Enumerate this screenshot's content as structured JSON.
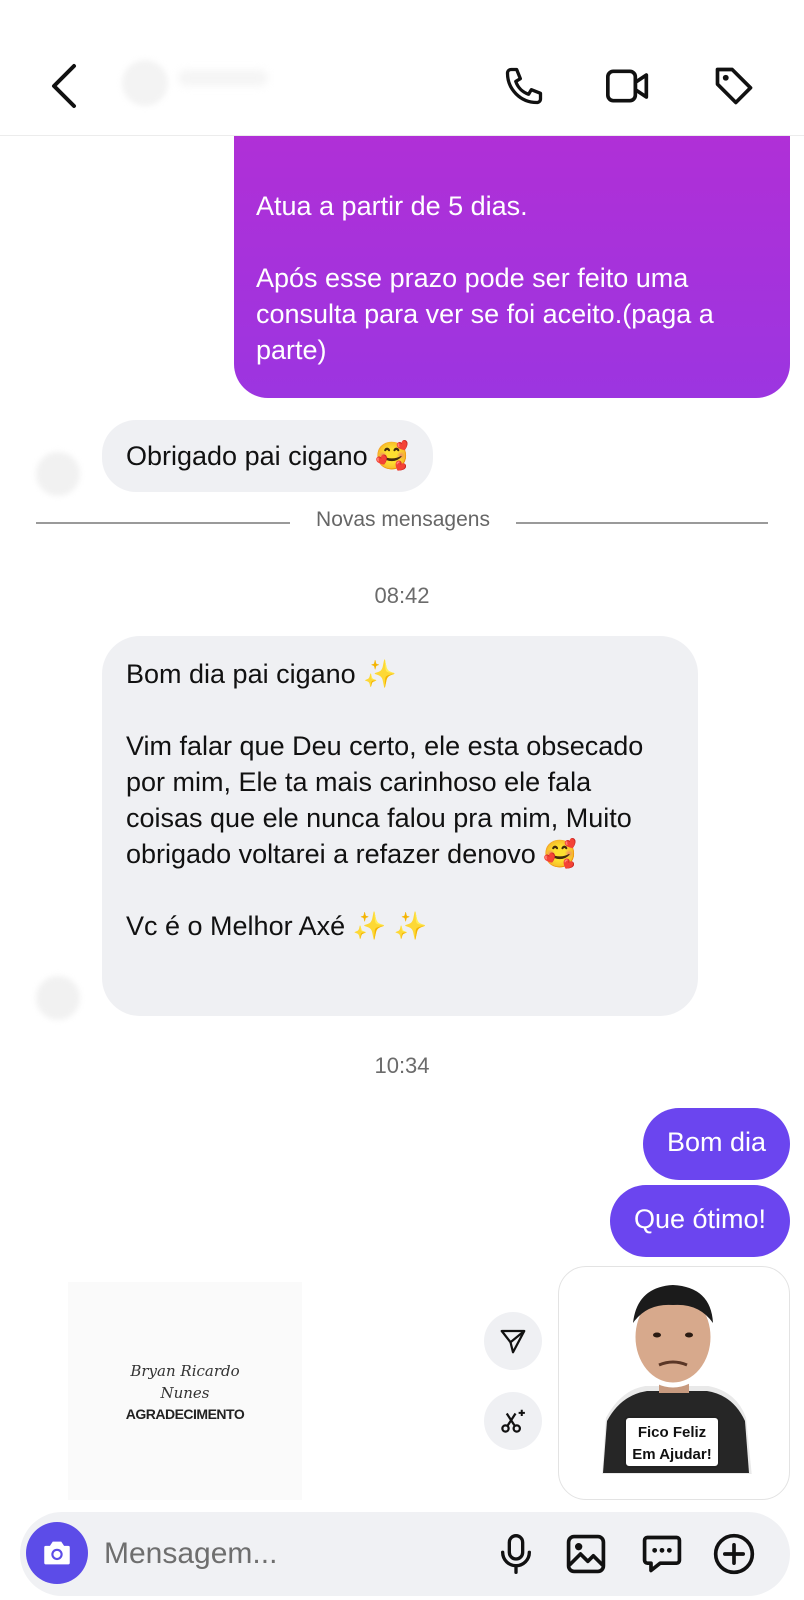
{
  "header": {
    "back_icon": "chevron-left-icon",
    "call_icon": "phone-icon",
    "video_icon": "video-camera-icon",
    "tag_icon": "tag-icon"
  },
  "messages": {
    "outgoing_long": "Atua a partir de 5 dias.\n\nApós esse prazo pode ser feito uma consulta para ver se foi aceito.(paga a parte)",
    "incoming_obrigado": "Obrigado pai cigano 🥰",
    "divider_label": "Novas mensagens",
    "time_1": "08:42",
    "incoming_long": "Bom dia pai cigano ✨\n\nVim falar que Deu certo, ele esta obsecado por mim, Ele ta mais carinhoso ele fala coisas que ele nunca falou pra mim, Muito obrigado voltarei a refazer denovo 🥰\n\nVc é o Melhor Axé ✨ ✨",
    "time_2": "10:34",
    "outgoing_bomdia": "Bom dia",
    "outgoing_otimo": "Que ótimo!"
  },
  "card": {
    "script_line_1": "Bryan Ricardo",
    "script_line_2": "Nunes",
    "caps": "AGRADECIMENTO"
  },
  "sticker": {
    "line_1": "Fico Feliz",
    "line_2": "Em Ajudar!"
  },
  "composer": {
    "placeholder": "Mensagem...",
    "camera_icon": "camera-icon",
    "mic_icon": "microphone-icon",
    "gallery_icon": "image-icon",
    "chat_icon": "message-icon",
    "plus_icon": "plus-circle-icon"
  },
  "colors": {
    "outgoing_gradient_top": "#b12fd6",
    "outgoing_purple": "#6b45ef",
    "incoming_gray": "#eff0f3",
    "camera_button": "#5c4ce8"
  }
}
